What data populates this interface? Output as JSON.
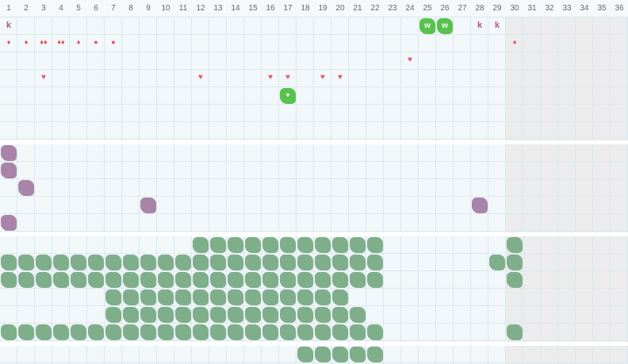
{
  "days": [
    "1",
    "2",
    "3",
    "4",
    "5",
    "6",
    "7",
    "8",
    "9",
    "10",
    "11",
    "12",
    "13",
    "14",
    "15",
    "16",
    "17",
    "18",
    "19",
    "20",
    "21",
    "22",
    "23",
    "24",
    "25",
    "26",
    "27",
    "28",
    "29",
    "30",
    "31",
    "32",
    "33",
    "34",
    "35",
    "36"
  ],
  "greyed_from_day": 30,
  "section1": {
    "k_markers": [
      {
        "day": 1,
        "label": "k"
      },
      {
        "day": 28,
        "label": "k"
      },
      {
        "day": 29,
        "label": "k"
      }
    ],
    "w_badges": [
      {
        "day": 25,
        "label": "w"
      },
      {
        "day": 26,
        "label": "w"
      }
    ],
    "drops": [
      {
        "day": 1,
        "glyph": "♦"
      },
      {
        "day": 2,
        "glyph": "♦"
      },
      {
        "day": 3,
        "glyph": "♦♦"
      },
      {
        "day": 4,
        "glyph": "♦♦"
      },
      {
        "day": 5,
        "glyph": "♦"
      },
      {
        "day": 6,
        "glyph": "●"
      },
      {
        "day": 7,
        "glyph": "●"
      },
      {
        "day": 30,
        "glyph": "♦"
      }
    ],
    "hearts_row3": [
      {
        "day": 24,
        "glyph": "♥"
      }
    ],
    "hearts_row4": [
      {
        "day": 3,
        "glyph": "♥"
      },
      {
        "day": 12,
        "glyph": "♥"
      },
      {
        "day": 16,
        "glyph": "♥"
      },
      {
        "day": 17,
        "glyph": "♥"
      },
      {
        "day": 19,
        "glyph": "♥"
      },
      {
        "day": 20,
        "glyph": "♥"
      }
    ],
    "plus_badge": {
      "day": 17,
      "label": "+"
    }
  },
  "section2": {
    "blobs": [
      {
        "day": 1,
        "row": 0
      },
      {
        "day": 1,
        "row": 1
      },
      {
        "day": 2,
        "row": 2
      },
      {
        "day": 9,
        "row": 3
      },
      {
        "day": 28,
        "row": 3
      },
      {
        "day": 1,
        "row": 4
      }
    ]
  },
  "section3": {
    "rows": [
      {
        "ranges": [
          [
            12,
            22
          ],
          [
            30,
            30
          ]
        ]
      },
      {
        "ranges": [
          [
            1,
            22
          ],
          [
            29,
            30
          ]
        ]
      },
      {
        "ranges": [
          [
            1,
            22
          ],
          [
            30,
            30
          ]
        ]
      },
      {
        "ranges": [
          [
            7,
            20
          ]
        ]
      },
      {
        "ranges": [
          [
            7,
            21
          ]
        ]
      },
      {
        "ranges": [
          [
            1,
            22
          ],
          [
            30,
            30
          ]
        ]
      }
    ]
  },
  "section4": {
    "rows": [
      {
        "ranges": [
          [
            18,
            22
          ]
        ]
      }
    ]
  },
  "colors": {
    "grid_bg": "#f2f7fa",
    "grid_line": "#d9e8ee",
    "greyed": "#ececec",
    "green_blob": "#7fae8b",
    "purple_blob": "#a884a8",
    "lime_badge": "#58c24c",
    "marker_red": "#e4525d",
    "marker_k": "#b05876"
  }
}
